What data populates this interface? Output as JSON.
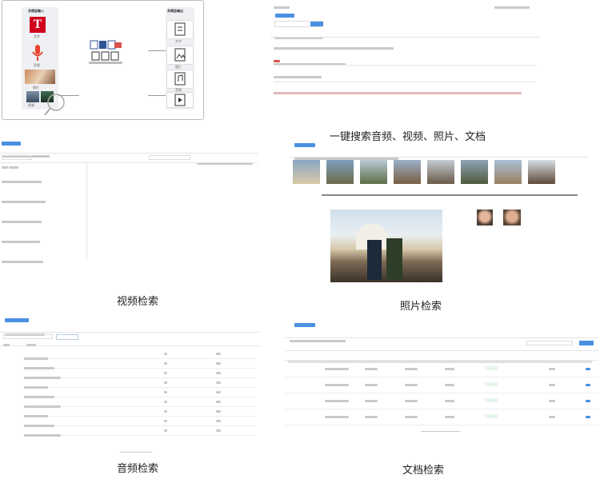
{
  "captions": {
    "search_all": "一键搜索音频、视频、照片、文档",
    "video_search": "视频检索",
    "photo_search": "照片检索",
    "audio_search": "音频检索",
    "doc_search": "文档检索"
  },
  "panel_flow": {
    "input_title": "多模态输入",
    "output_title": "多模态输出",
    "inputs": [
      "文字",
      "音频",
      "图片",
      "视频"
    ],
    "outputs": [
      "文字",
      "图片",
      "音频",
      "视频"
    ]
  },
  "colors": {
    "accent": "#4a90e2",
    "text_logo": "#d0021b",
    "mic": "#e8432e",
    "status_green": "#39a55a"
  }
}
